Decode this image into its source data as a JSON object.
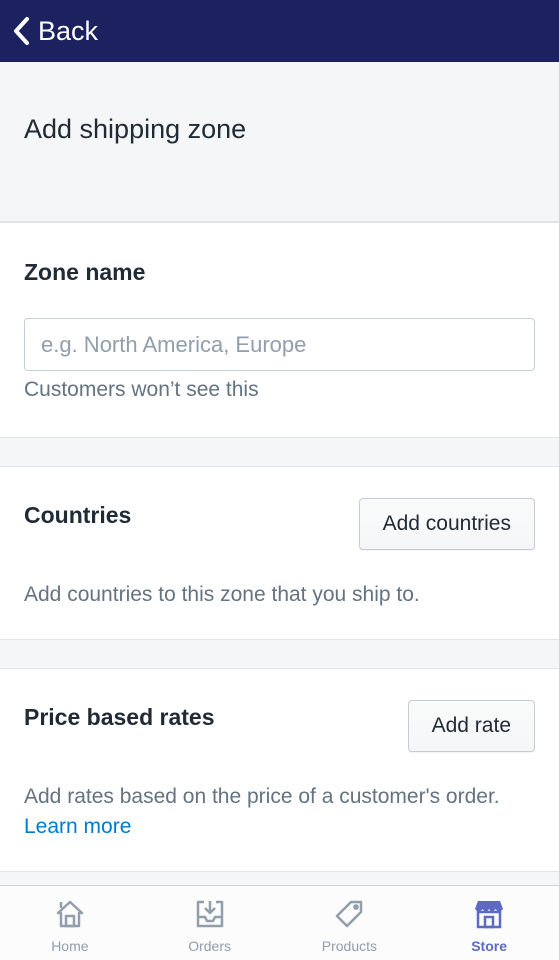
{
  "nav": {
    "back_label": "Back"
  },
  "header": {
    "title": "Add shipping zone"
  },
  "zone_name": {
    "title": "Zone name",
    "placeholder": "e.g. North America, Europe",
    "value": "",
    "help": "Customers won’t see this"
  },
  "countries": {
    "title": "Countries",
    "button_label": "Add countries",
    "description": "Add countries to this zone that you ship to."
  },
  "price_rates": {
    "title": "Price based rates",
    "button_label": "Add rate",
    "description": "Add rates based on the price of a customer's order.",
    "link_label": "Learn more"
  },
  "tabbar": {
    "items": [
      {
        "label": "Home",
        "icon": "home-icon",
        "active": false
      },
      {
        "label": "Orders",
        "icon": "orders-icon",
        "active": false
      },
      {
        "label": "Products",
        "icon": "tag-icon",
        "active": false
      },
      {
        "label": "Store",
        "icon": "store-icon",
        "active": true
      }
    ],
    "active_color": "#5c6ac4",
    "inactive_color": "#919eab"
  },
  "colors": {
    "topbar": "#1c2260",
    "link": "#007ace"
  }
}
